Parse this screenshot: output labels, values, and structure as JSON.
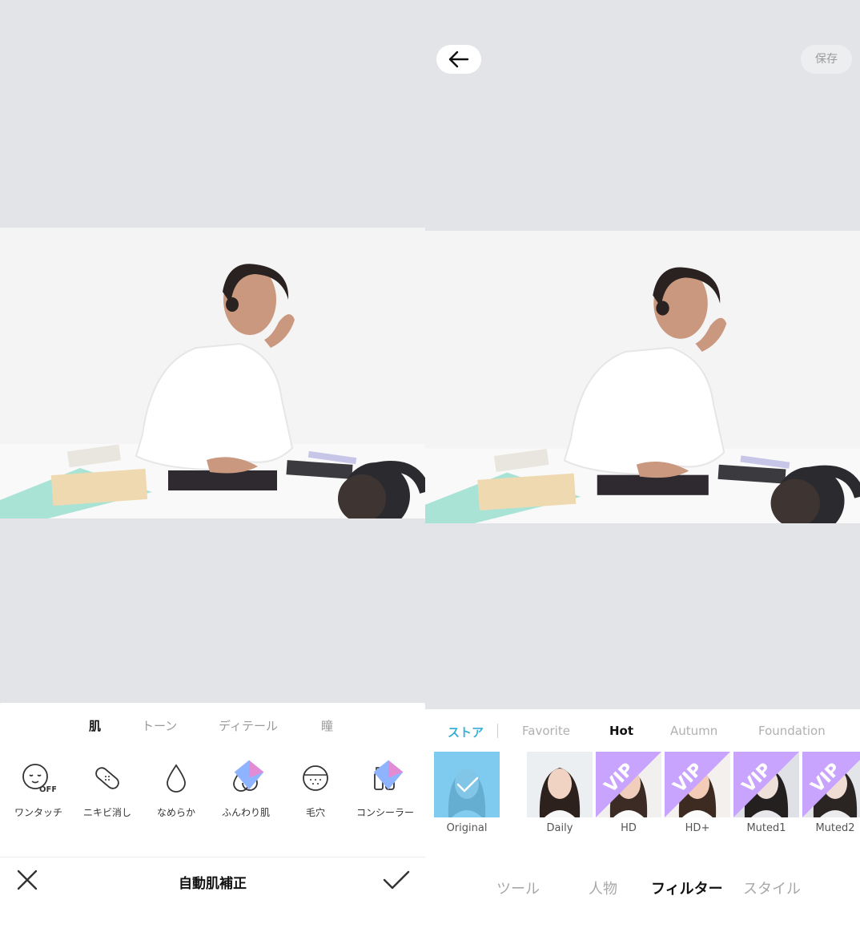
{
  "left_panel": {
    "tabs": [
      "肌",
      "トーン",
      "ディテール",
      "瞳"
    ],
    "active_tab": "肌",
    "tools": [
      {
        "label": "ワンタッチ",
        "icon": "face-off-icon"
      },
      {
        "label": "ニキビ消し",
        "icon": "bandage-icon"
      },
      {
        "label": "なめらか",
        "icon": "droplet-icon"
      },
      {
        "label": "ふんわり肌",
        "icon": "double-droplet-icon"
      },
      {
        "label": "毛穴",
        "icon": "pores-icon"
      },
      {
        "label": "コンシーラー",
        "icon": "concealer-icon"
      }
    ],
    "off_badge": "OFF",
    "title": "自動肌補正"
  },
  "right_panel": {
    "save_label": "保存",
    "filter_tabs": [
      "ストア",
      "Favorite",
      "Hot",
      "Autumn",
      "Foundation"
    ],
    "active_filter_tab": "Hot",
    "filters": [
      {
        "name": "Original",
        "selected": true,
        "vip": false
      },
      {
        "name": "Daily",
        "selected": false,
        "vip": false
      },
      {
        "name": "HD",
        "selected": false,
        "vip": true
      },
      {
        "name": "HD+",
        "selected": false,
        "vip": true
      },
      {
        "name": "Muted1",
        "selected": false,
        "vip": true
      },
      {
        "name": "Muted2",
        "selected": false,
        "vip": true
      }
    ],
    "vip_badge": "VIP",
    "bottom_nav": [
      "ツール",
      "人物",
      "フィルター",
      "スタイル"
    ],
    "active_bottom_nav": "フィルター"
  },
  "colors": {
    "canvas_bg": "#e2e4e7",
    "accent": "#3aafd8",
    "vip_badge": "#c9a4ff",
    "selected_overlay": "#6ec6ef"
  }
}
